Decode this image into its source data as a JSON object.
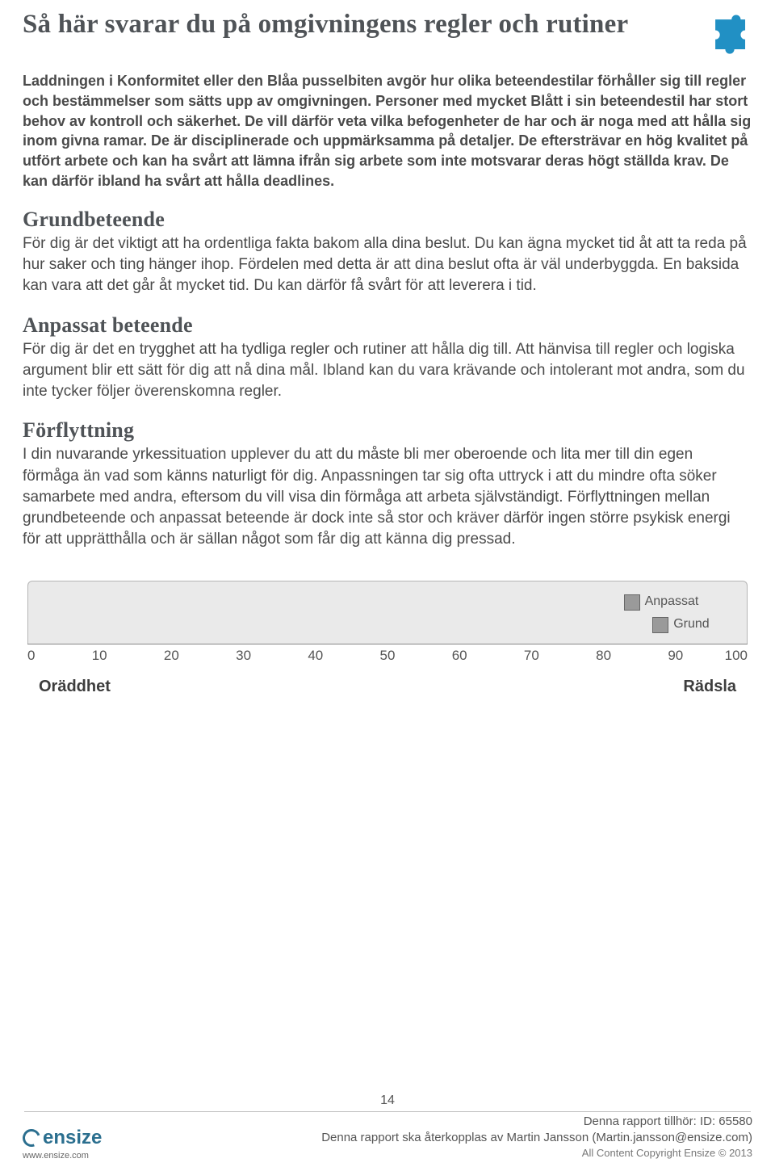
{
  "title": "Så här svarar du på omgivningens regler och rutiner",
  "intro": "Laddningen i Konformitet eller den Blåa pusselbiten avgör hur olika beteendestilar förhåller sig till regler och bestämmelser som sätts upp av omgivningen. Personer med mycket Blått i sin beteendestil har stort behov av kontroll och säkerhet. De vill därför veta vilka befogenheter de har och är noga med att hålla sig inom givna ramar. De är disciplinerade och uppmärksamma på detaljer. De eftersträvar en hög kvalitet på utfört arbete och kan ha svårt att lämna ifrån sig arbete som inte motsvarar deras högt ställda krav. De kan därför ibland ha svårt att hålla deadlines.",
  "sections": [
    {
      "heading": "Grundbeteende",
      "text": "För dig är det viktigt att ha ordentliga fakta bakom alla dina beslut. Du kan ägna mycket tid åt att ta reda på hur saker och ting hänger ihop. Fördelen med detta är att dina beslut ofta är väl underbyggda. En baksida kan vara att det går åt mycket tid. Du kan därför få svårt för att leverera i tid."
    },
    {
      "heading": "Anpassat beteende",
      "text": "För dig är det en trygghet att ha tydliga regler och rutiner att hålla dig till. Att hänvisa till regler och logiska argument blir ett sätt för dig att nå dina mål. Ibland kan du vara krävande och intolerant mot andra, som du inte tycker följer överenskomna regler."
    },
    {
      "heading": "Förflyttning",
      "text": "I din nuvarande yrkessituation upplever du att du måste bli mer oberoende och lita mer till din egen förmåga än vad som känns naturligt för dig. Anpassningen tar sig ofta uttryck i att du mindre ofta söker samarbete med andra, eftersom du vill visa din förmåga att arbeta självständigt. Förflyttningen mellan grundbeteende och anpassat beteende är dock inte så stor och kräver därför ingen större psykisk energi för att upprätthålla och är sällan något som får dig att känna dig pressad."
    }
  ],
  "chart_data": {
    "type": "scatter",
    "xlim": [
      0,
      100
    ],
    "ticks": [
      0,
      10,
      20,
      30,
      40,
      50,
      60,
      70,
      80,
      90,
      100
    ],
    "left_label": "Oräddhet",
    "right_label": "Rädsla",
    "series": [
      {
        "name": "Anpassat",
        "value": 84
      },
      {
        "name": "Grund",
        "value": 88
      }
    ]
  },
  "page_number": "14",
  "footer": {
    "brand": "ensize",
    "url": "www.ensize.com",
    "line1": "Denna rapport tillhör: ID: 65580",
    "line2": "Denna rapport ska återkopplas av Martin Jansson (Martin.jansson@ensize.com)",
    "copy": "All Content Copyright Ensize © 2013"
  }
}
